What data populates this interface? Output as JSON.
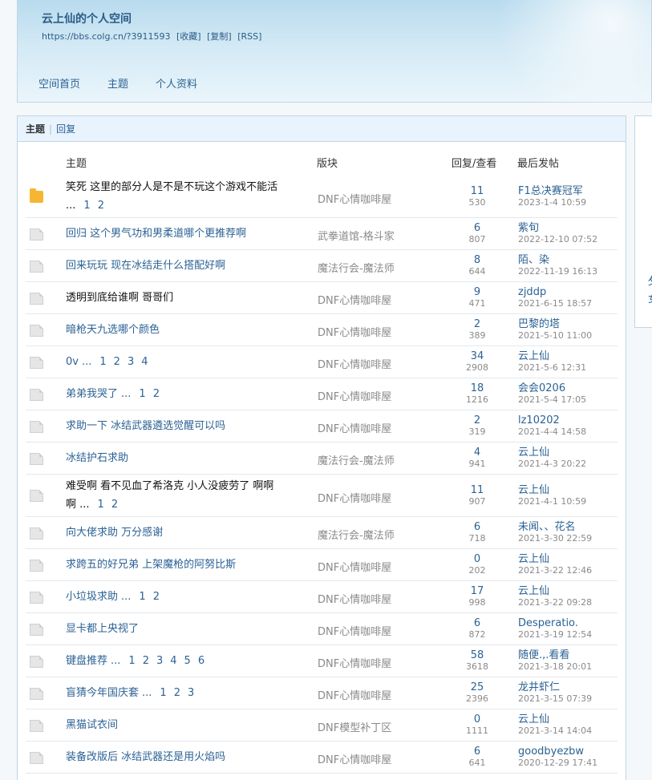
{
  "space": {
    "title": "云上仙的个人空间",
    "url": "https://bbs.colg.cn/?3911593",
    "links": [
      "[收藏]",
      "[复制]",
      "[RSS]"
    ]
  },
  "nav": [
    "空间首页",
    "主题",
    "个人资料"
  ],
  "tabs": {
    "active": "主题",
    "separator": "|",
    "other": "回复"
  },
  "columns": {
    "subject": "主题",
    "forum": "版块",
    "replies": "回复/查看",
    "last": "最后发帖"
  },
  "side_chars": [
    "攵",
    "女"
  ],
  "rows": [
    {
      "icon": "folder-icon",
      "title_line1": "笑死 这里的部分人是不是不玩这个游戏不能活",
      "title_line2": "...",
      "pages": [
        "1",
        "2"
      ],
      "dark": true,
      "tall": true,
      "forum": "DNF心情咖啡屋",
      "replies": "11",
      "views": "530",
      "user": "F1总决赛冠军",
      "date": "2023-1-4 10:59"
    },
    {
      "icon": "doc-icon",
      "title_line1": "回归 这个男气功和男柔道哪个更推荐啊",
      "pages": [],
      "dark": false,
      "tall": false,
      "forum": "武拳道馆-格斗家",
      "replies": "6",
      "views": "807",
      "user": "紫旬",
      "date": "2022-12-10 07:52"
    },
    {
      "icon": "doc-icon",
      "title_line1": "回来玩玩 现在冰结走什么搭配好啊",
      "pages": [],
      "dark": false,
      "tall": false,
      "forum": "魔法行会-魔法师",
      "replies": "8",
      "views": "644",
      "user": "陌、染",
      "date": "2022-11-19 16:13"
    },
    {
      "icon": "doc-icon",
      "title_line1": "透明到底给谁啊 哥哥们",
      "pages": [],
      "dark": true,
      "tall": false,
      "forum": "DNF心情咖啡屋",
      "replies": "9",
      "views": "471",
      "user": "zjddp",
      "date": "2021-6-15 18:57"
    },
    {
      "icon": "doc-icon",
      "title_line1": "暗枪天九选哪个颜色",
      "pages": [],
      "dark": false,
      "tall": false,
      "forum": "DNF心情咖啡屋",
      "replies": "2",
      "views": "389",
      "user": "巴黎的塔",
      "date": "2021-5-10 11:00"
    },
    {
      "icon": "doc-icon",
      "title_line1": "0v",
      "ellipsis": "...",
      "pages": [
        "1",
        "2",
        "3",
        "4"
      ],
      "dark": false,
      "tall": false,
      "forum": "DNF心情咖啡屋",
      "replies": "34",
      "views": "2908",
      "user": "云上仙",
      "date": "2021-5-6 12:31"
    },
    {
      "icon": "doc-icon",
      "title_line1": "弟弟我哭了",
      "ellipsis": "...",
      "pages": [
        "1",
        "2"
      ],
      "dark": false,
      "tall": false,
      "forum": "DNF心情咖啡屋",
      "replies": "18",
      "views": "1216",
      "user": "会会0206",
      "date": "2021-5-4 17:05"
    },
    {
      "icon": "doc-icon",
      "title_line1": "求助一下 冰结武器遴选觉醒可以吗",
      "pages": [],
      "dark": false,
      "tall": false,
      "forum": "DNF心情咖啡屋",
      "replies": "2",
      "views": "319",
      "user": "lz10202",
      "date": "2021-4-4 14:58"
    },
    {
      "icon": "doc-icon",
      "title_line1": "冰结护石求助",
      "pages": [],
      "dark": false,
      "tall": false,
      "forum": "魔法行会-魔法师",
      "replies": "4",
      "views": "941",
      "user": "云上仙",
      "date": "2021-4-3 20:22"
    },
    {
      "icon": "doc-icon",
      "title_line1": "难受啊 看不见血了希洛克 小人没疲劳了 啊啊",
      "title_line2": "啊 ...",
      "pages": [
        "1",
        "2"
      ],
      "dark": true,
      "tall": true,
      "forum": "DNF心情咖啡屋",
      "replies": "11",
      "views": "907",
      "user": "云上仙",
      "date": "2021-4-1 10:59"
    },
    {
      "icon": "doc-icon",
      "title_line1": "向大佬求助 万分感谢",
      "pages": [],
      "dark": false,
      "tall": false,
      "forum": "魔法行会-魔法师",
      "replies": "6",
      "views": "718",
      "user": "未闻、、花名",
      "date": "2021-3-30 22:59"
    },
    {
      "icon": "doc-icon",
      "title_line1": "求跨五的好兄弟 上架魔枪的阿努比斯",
      "pages": [],
      "dark": false,
      "tall": false,
      "forum": "DNF心情咖啡屋",
      "replies": "0",
      "views": "202",
      "user": "云上仙",
      "date": "2021-3-22 12:46"
    },
    {
      "icon": "doc-icon",
      "title_line1": "小垃圾求助",
      "ellipsis": "...",
      "pages": [
        "1",
        "2"
      ],
      "dark": false,
      "tall": false,
      "forum": "DNF心情咖啡屋",
      "replies": "17",
      "views": "998",
      "user": "云上仙",
      "date": "2021-3-22 09:28"
    },
    {
      "icon": "doc-icon",
      "title_line1": "显卡都上央视了",
      "pages": [],
      "dark": false,
      "tall": false,
      "forum": "DNF心情咖啡屋",
      "replies": "6",
      "views": "872",
      "user": "Desperatio.",
      "date": "2021-3-19 12:54"
    },
    {
      "icon": "doc-icon",
      "title_line1": "键盘推荐",
      "ellipsis": "...",
      "pages": [
        "1",
        "2",
        "3",
        "4",
        "5",
        "6"
      ],
      "dark": false,
      "tall": false,
      "forum": "DNF心情咖啡屋",
      "replies": "58",
      "views": "3618",
      "user": "随便.,.看看",
      "date": "2021-3-18 20:01"
    },
    {
      "icon": "doc-icon",
      "title_line1": "盲猜今年国庆套",
      "ellipsis": "...",
      "pages": [
        "1",
        "2",
        "3"
      ],
      "dark": false,
      "tall": false,
      "forum": "DNF心情咖啡屋",
      "replies": "25",
      "views": "2396",
      "user": "龙井虾仁",
      "date": "2021-3-15 07:39"
    },
    {
      "icon": "doc-icon",
      "title_line1": "黑猫试衣间",
      "pages": [],
      "dark": false,
      "tall": false,
      "forum": "DNF模型补丁区",
      "replies": "0",
      "views": "1111",
      "user": "云上仙",
      "date": "2021-3-14 14:04"
    },
    {
      "icon": "doc-icon",
      "title_line1": "装备改版后 冰结武器还是用火焰吗",
      "pages": [],
      "dark": false,
      "tall": false,
      "forum": "DNF心情咖啡屋",
      "replies": "6",
      "views": "641",
      "user": "goodbyezbw",
      "date": "2020-12-29 17:41"
    }
  ]
}
